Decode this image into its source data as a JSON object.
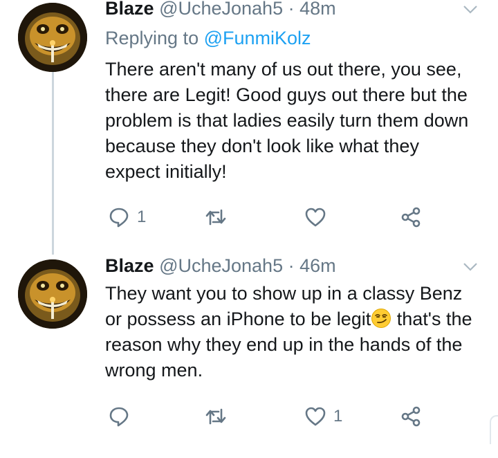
{
  "tweets": [
    {
      "name": "Blaze",
      "handle": "@UcheJonah5",
      "dot": "·",
      "time": "48m",
      "replying_label": "Replying to",
      "replying_to": "@FunmiKolz",
      "text": "There aren't many of us out there, you see, there are Legit! Good guys out there but the problem is that ladies easily turn them down because they don't look like what they expect initially!",
      "reply_count": "1",
      "retweet_count": "",
      "like_count": ""
    },
    {
      "name": "Blaze",
      "handle": "@UcheJonah5",
      "dot": "·",
      "time": "46m",
      "text_before_emoji": "They want you to show up in a classy Benz or possess an iPhone to be legit",
      "text_after_emoji": " that's the reason why they end up in the hands of the wrong men.",
      "emoji": "smirking-face",
      "reply_count": "",
      "retweet_count": "",
      "like_count": "1"
    }
  ],
  "colors": {
    "text": "#14171a",
    "muted": "#657786",
    "link": "#1da1f2",
    "thread_line": "#ccd6dd"
  },
  "icons": [
    "reply-icon",
    "retweet-icon",
    "like-icon",
    "share-icon",
    "chevron-down-icon"
  ]
}
